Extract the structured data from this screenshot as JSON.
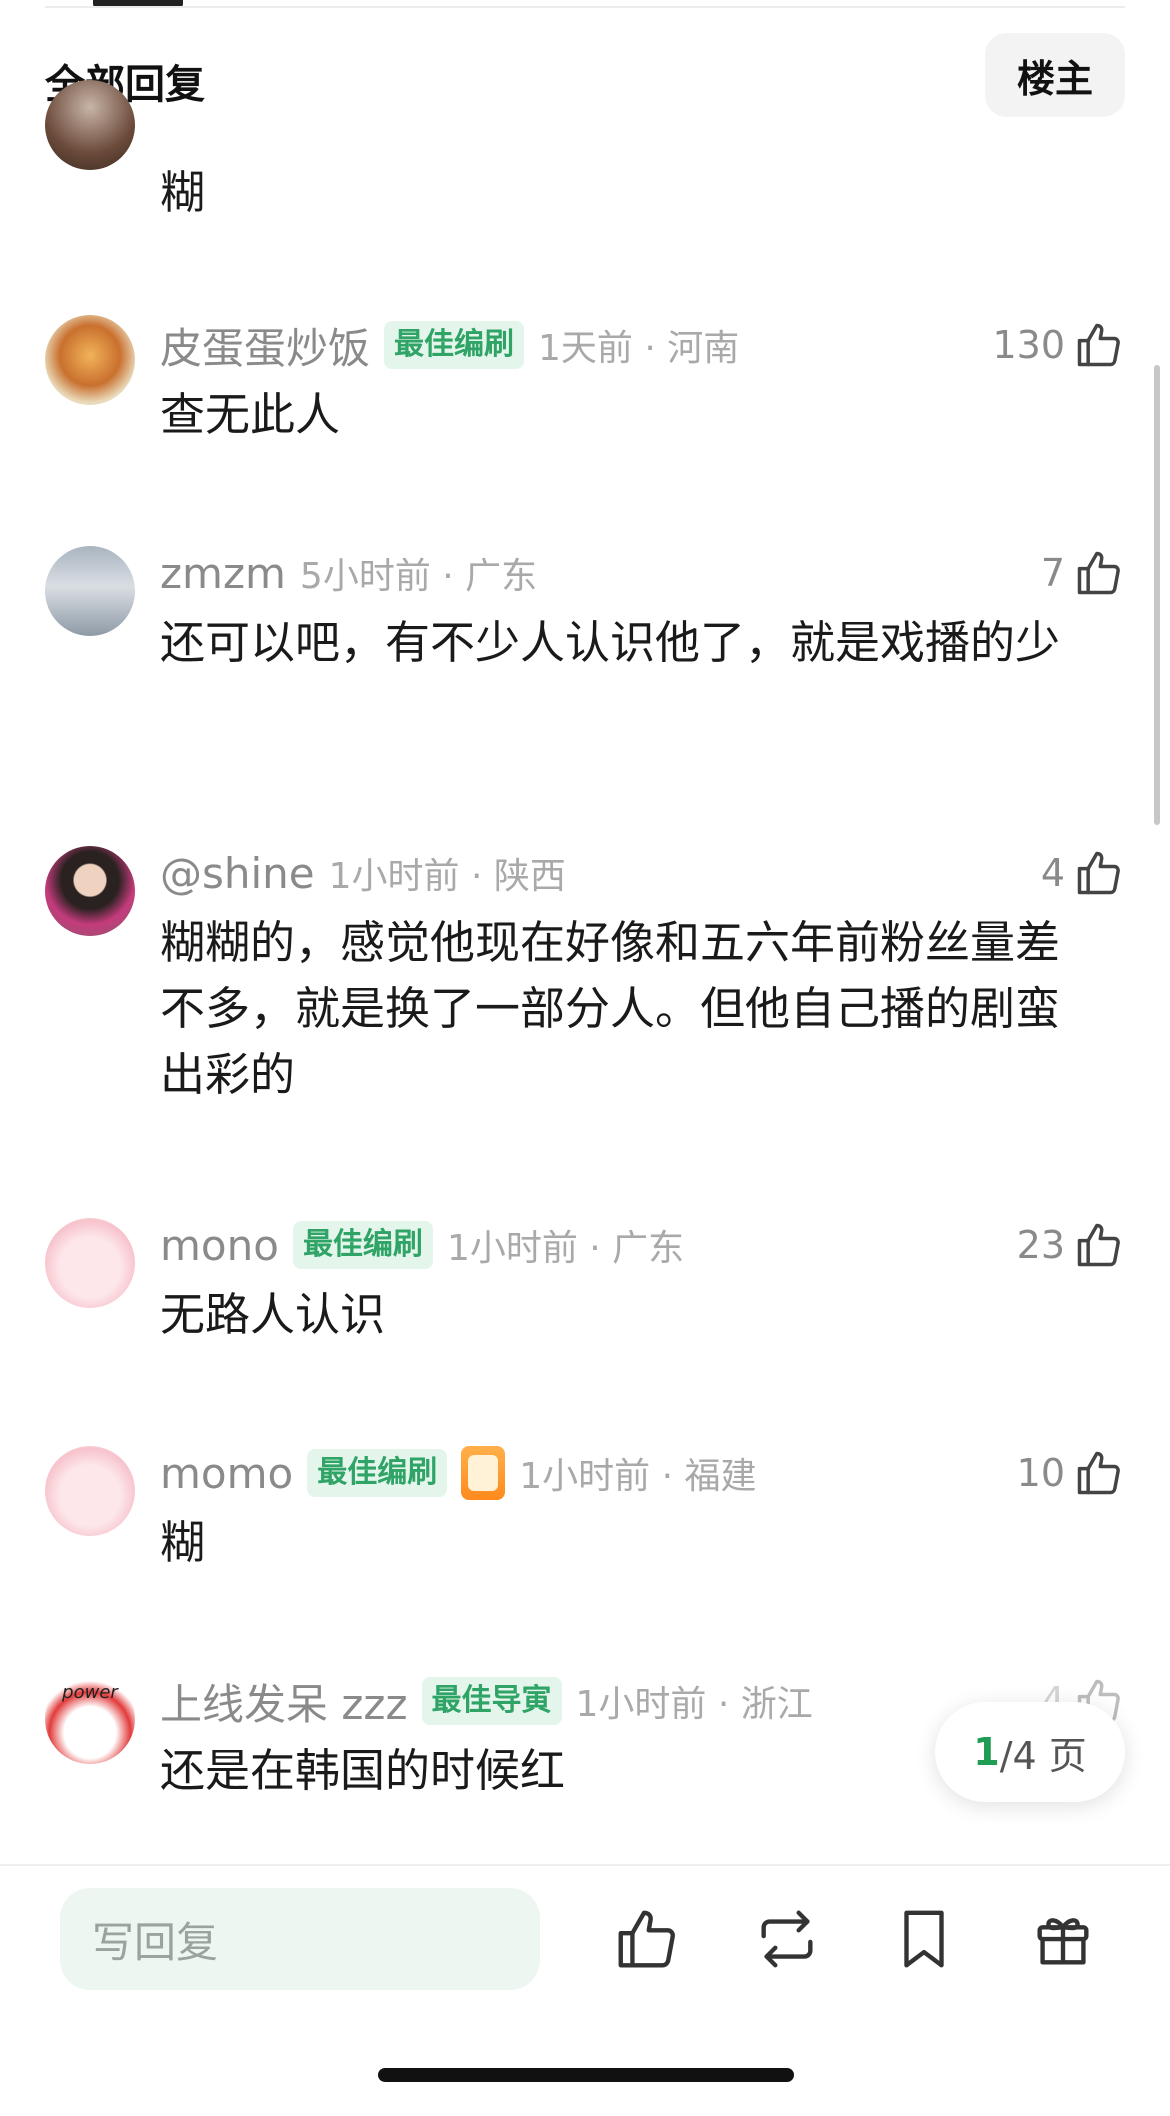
{
  "header": {
    "title": "全部回复",
    "op_button": "楼主"
  },
  "comments": [
    {
      "body": "糊"
    },
    {
      "username": "皮蛋蛋炒饭",
      "badge": "最佳编刷",
      "time": "1天前 · 河南",
      "likes": "130",
      "body": "查无此人"
    },
    {
      "username": "zmzm",
      "time": "5小时前 · 广东",
      "likes": "7",
      "body": "还可以吧，有不少人认识他了，就是戏播的少"
    },
    {
      "username": "@shine",
      "time": "1小时前 · 陕西",
      "likes": "4",
      "body": "糊糊的，感觉他现在好像和五六年前粉丝量差不多，就是换了一部分人。但他自己播的剧蛮出彩的"
    },
    {
      "username": "mono",
      "badge": "最佳编刷",
      "time": "1小时前 · 广东",
      "likes": "23",
      "body": "无路人认识"
    },
    {
      "username": "momo",
      "badge": "最佳编刷",
      "time": "1小时前 · 福建",
      "likes": "10",
      "body": "糊"
    },
    {
      "username": "上线发呆 zzz",
      "badge": "最佳导寅",
      "time": "1小时前 · 浙江",
      "likes": "4",
      "body": "还是在韩国的时候红",
      "avatar_text": "power"
    }
  ],
  "pager": {
    "current": "1",
    "total": "/4 页"
  },
  "bottom_bar": {
    "reply_placeholder": "写回复"
  },
  "colors": {
    "accent": "#1f9d55",
    "badge_bg": "#e4f6ec",
    "badge_text": "#2fa466"
  },
  "icons": [
    "thumbs-up-icon",
    "repost-icon",
    "bookmark-icon",
    "gift-icon"
  ]
}
